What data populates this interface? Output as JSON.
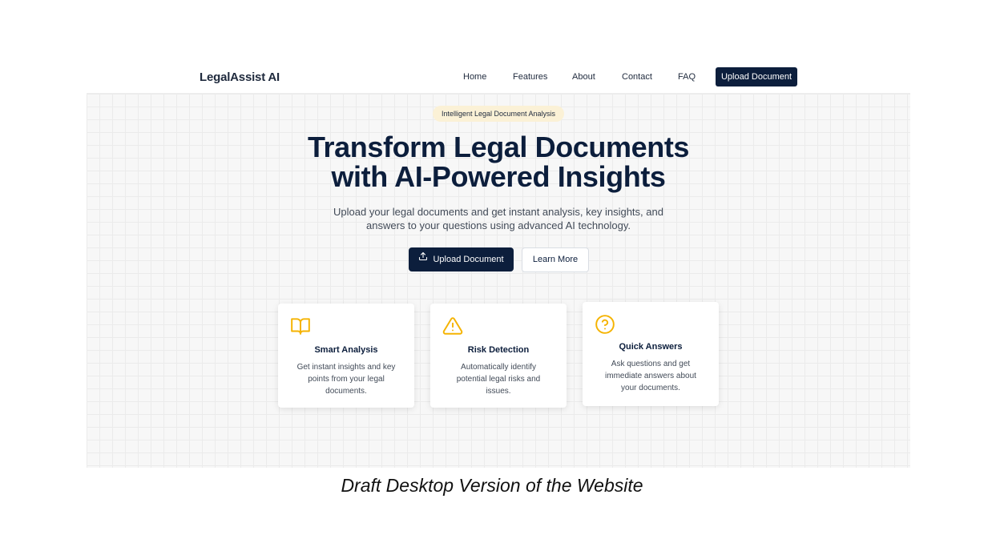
{
  "nav": {
    "brand": "LegalAssist AI",
    "links": [
      "Home",
      "Features",
      "About",
      "Contact",
      "FAQ"
    ],
    "cta_label": "Upload Document"
  },
  "hero": {
    "badge": "Intelligent Legal Document Analysis",
    "headline_lines": [
      "Transform Legal Documents",
      "with AI-Powered Insights"
    ],
    "subtext_lines": [
      "Upload your legal documents and get instant analysis, key insights, and",
      "answers to your questions using advanced AI technology."
    ],
    "primary_button": {
      "label": "Upload Document",
      "icon": "upload-icon"
    },
    "secondary_button": {
      "label": "Learn More"
    }
  },
  "features": [
    {
      "icon": "book-open-icon",
      "title": "Smart Analysis",
      "desc_lines": [
        "Get instant insights and key",
        "points from your legal",
        "documents."
      ]
    },
    {
      "icon": "alert-triangle-icon",
      "title": "Risk Detection",
      "desc_lines": [
        "Automatically identify",
        "potential legal risks and",
        "issues."
      ]
    },
    {
      "icon": "help-circle-icon",
      "title": "Quick Answers",
      "desc_lines": [
        "Ask questions and get",
        "immediate answers about",
        "your documents."
      ]
    }
  ],
  "caption": "Draft Desktop Version of the Website",
  "colors": {
    "navy": "#0c1e3c",
    "accent_yellow": "#f5b301",
    "badge_bg": "#fbf1d6",
    "hero_bg": "#f7f7f7"
  }
}
